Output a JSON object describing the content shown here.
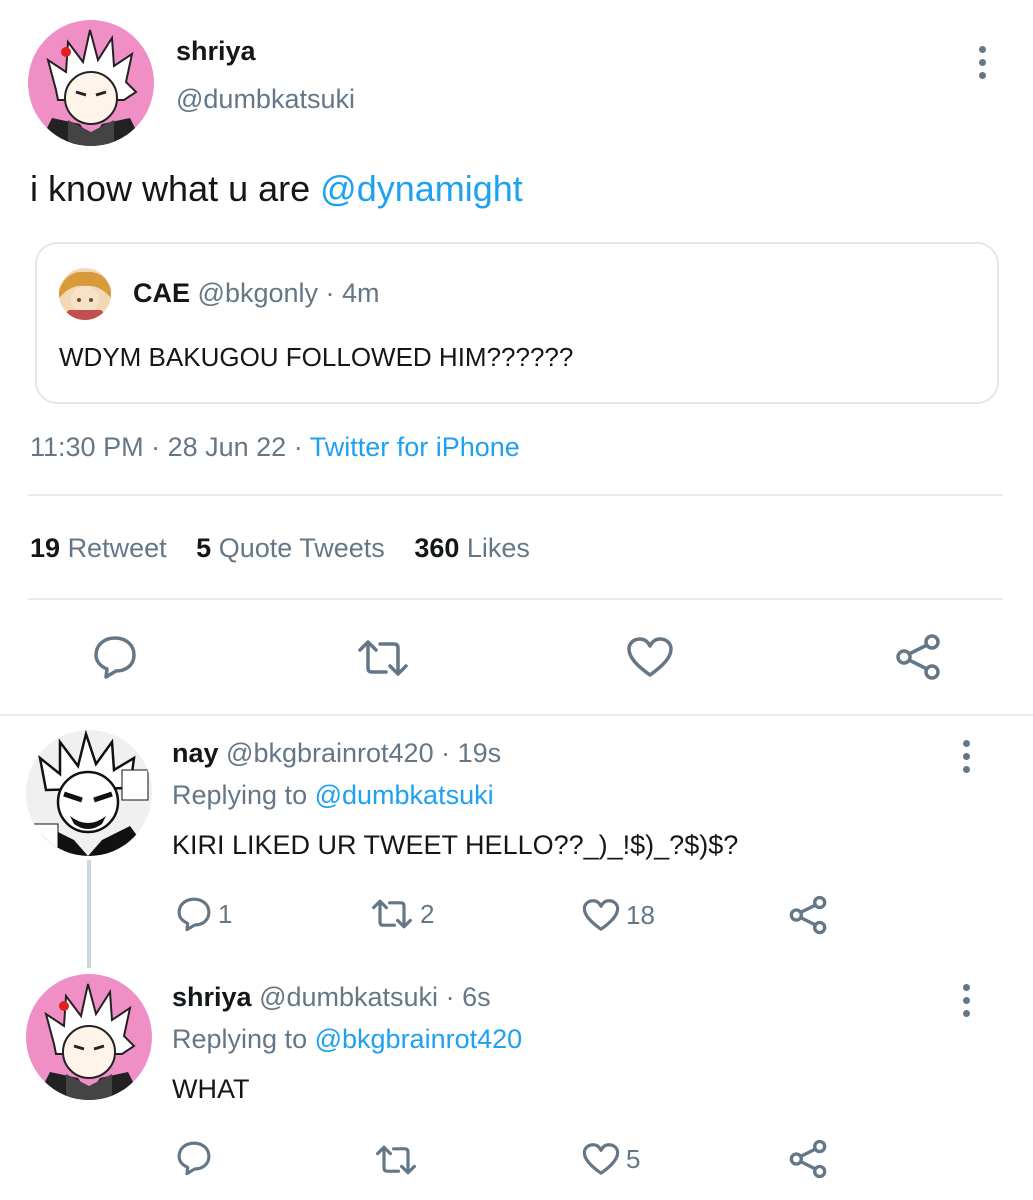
{
  "main_tweet": {
    "display_name": "shriya",
    "handle": "@dumbkatsuki",
    "text_plain": "i know what u are ",
    "text_mention": "@dynamight",
    "quoted": {
      "display_name": "CAE",
      "handle": "@bkgonly",
      "time": "· 4m",
      "text": "WDYM BAKUGOU FOLLOWED HIM??????"
    },
    "time": "11:30 PM",
    "date": "· 28 Jun 22 ·",
    "source": "Twitter for iPhone",
    "stats": {
      "retweets_count": "19",
      "retweets_label": "Retweet",
      "quotes_count": "5",
      "quotes_label": "Quote Tweets",
      "likes_count": "360",
      "likes_label": "Likes"
    }
  },
  "replies": [
    {
      "display_name": "nay",
      "handle": "@bkgbrainrot420",
      "time": "· 19s",
      "replying_label": "Replying to",
      "replying_to": "@dumbkatsuki",
      "text": "KIRI LIKED UR TWEET HELLO??_)_!$)_?$)$?",
      "reply_count": "1",
      "retweet_count": "2",
      "like_count": "18"
    },
    {
      "display_name": "shriya",
      "handle": "@dumbkatsuki",
      "time": "· 6s",
      "replying_label": "Replying to",
      "replying_to": "@bkgbrainrot420",
      "text": "WHAT",
      "reply_count": "",
      "retweet_count": "",
      "like_count": "5"
    }
  ],
  "icons": {
    "reply": "reply-icon",
    "retweet": "retweet-icon",
    "like": "heart-icon",
    "share": "share-icon",
    "more": "more-vertical-icon"
  },
  "colors": {
    "link": "#1da1f2",
    "secondary": "#657786",
    "avatar_bg": "#f090c8"
  }
}
